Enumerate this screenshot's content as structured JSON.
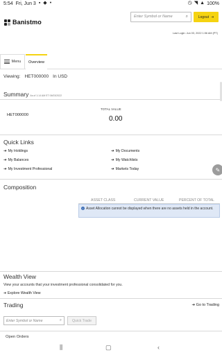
{
  "status_bar": {
    "time": "5:54",
    "date": "Fri, Jun 3",
    "battery": "100%"
  },
  "brand": {
    "name": "Banistmo"
  },
  "header": {
    "search_placeholder": "Enter Symbol or Name",
    "logout_label": "Logout",
    "last_login": "Last Login: Jun 03, 2022 1:56 AM (PT)"
  },
  "tabs": {
    "menu_label": "Menu",
    "overview_label": "Overview"
  },
  "viewing": {
    "label": "Viewing:",
    "account": "HET000000",
    "currency": "In USD"
  },
  "summary": {
    "title": "Summary",
    "as_of": "As of 1:14 AM ET 06/03/2022",
    "account": "HET000000",
    "total_value_label": "TOTAL VALUE",
    "total_value": "0.00"
  },
  "quick_links": {
    "title": "Quick Links",
    "items": [
      "My Holdings",
      "My Documents",
      "My Balances",
      "My Watchlists",
      "My Investment Professional",
      "Markets Today"
    ]
  },
  "composition": {
    "title": "Composition",
    "columns": [
      "ASSET CLASS",
      "CURRENT VALUE",
      "PERCENT OF TOTAL"
    ],
    "info_message": "Asset Allocation cannot be displayed when there are no assets held in the account."
  },
  "wealth_view": {
    "title": "Wealth View",
    "description": "View your accounts that your investment professional consolidated for you.",
    "link": "Explore Wealth View"
  },
  "trading": {
    "title": "Trading",
    "goto_link": "Go to Trading",
    "search_placeholder": "Enter Symbol or Name",
    "quick_trade_label": "Quick Trade"
  },
  "open_orders": {
    "title": "Open Orders"
  },
  "colors": {
    "accent": "#f5d311",
    "info_bg": "#dfe8f6"
  }
}
